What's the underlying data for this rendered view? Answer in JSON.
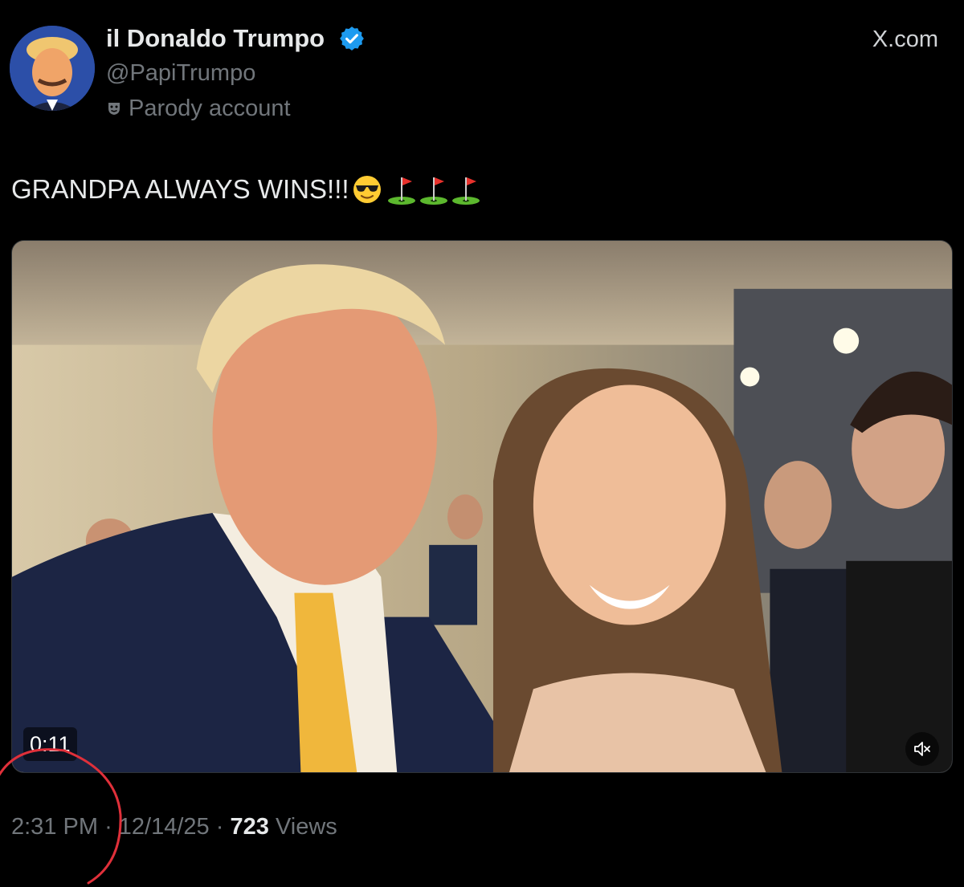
{
  "post": {
    "author": {
      "display_name": "il Donaldo Trumpo",
      "handle": "@PapiTrumpo",
      "badge": "Parody account",
      "verified": true,
      "verified_color": "#1d9bf0"
    },
    "source": "X.com",
    "text": "GRANDPA ALWAYS WINS!!!",
    "emojis": [
      "smiling-face-with-sunglasses",
      "flag-in-hole",
      "flag-in-hole",
      "flag-in-hole"
    ],
    "media": {
      "type": "video",
      "duration": "0:11",
      "muted": true
    },
    "meta": {
      "time": "2:31 PM",
      "separator": "·",
      "date": "12/14/25",
      "views_count": "723",
      "views_label": "Views"
    }
  },
  "colors": {
    "background": "#000000",
    "primary_text": "#e7e9ea",
    "secondary_text": "#71767b",
    "annotation": "#e0303a"
  }
}
